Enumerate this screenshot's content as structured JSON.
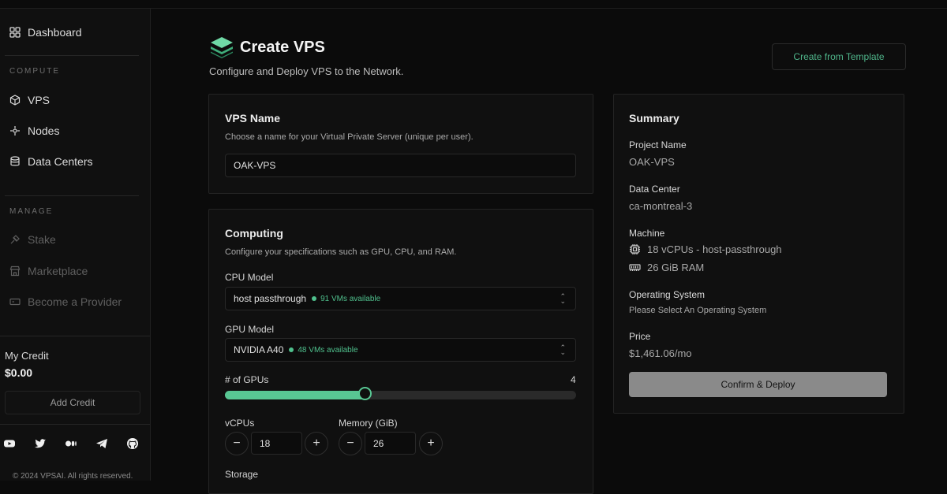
{
  "sidebar": {
    "dashboard": "Dashboard",
    "compute_label": "COMPUTE",
    "compute_items": [
      {
        "label": "VPS",
        "icon": "cube-icon"
      },
      {
        "label": "Nodes",
        "icon": "nodes-icon"
      },
      {
        "label": "Data Centers",
        "icon": "database-icon"
      }
    ],
    "manage_label": "MANAGE",
    "manage_items": [
      {
        "label": "Stake",
        "icon": "stake-icon"
      },
      {
        "label": "Marketplace",
        "icon": "store-icon"
      },
      {
        "label": "Become a Provider",
        "icon": "server-icon"
      }
    ],
    "credit_label": "My Credit",
    "credit_value": "$0.00",
    "add_credit": "Add Credit",
    "socials": [
      "youtube-icon",
      "twitter-icon",
      "medium-icon",
      "telegram-icon",
      "github-icon"
    ],
    "copyright": "© 2024 VPSAI. All rights reserved."
  },
  "header": {
    "title": "Create VPS",
    "subtitle": "Configure and Deploy VPS to the Network.",
    "template_button": "Create from Template"
  },
  "vps_name": {
    "title": "VPS Name",
    "description": "Choose a name for your Virtual Private Server (unique per user).",
    "value": "OAK-VPS"
  },
  "computing": {
    "title": "Computing",
    "description": "Configure your specifications such as GPU, CPU, and RAM.",
    "cpu_label": "CPU Model",
    "cpu_value": "host passthrough",
    "cpu_available": "91 VMs available",
    "gpu_label": "GPU Model",
    "gpu_value": "NVIDIA A40",
    "gpu_available": "48 VMs available",
    "gpus_label": "# of GPUs",
    "gpus_value": "4",
    "gpus_fill_fraction": 0.4,
    "vcpus_label": "vCPUs",
    "vcpus_value": "18",
    "memory_label": "Memory (GiB)",
    "memory_value": "26",
    "minus": "−",
    "plus": "+",
    "storage_label": "Storage"
  },
  "summary": {
    "title": "Summary",
    "project_label": "Project Name",
    "project_value": "OAK-VPS",
    "datacenter_label": "Data Center",
    "datacenter_value": "ca-montreal-3",
    "machine_label": "Machine",
    "machine_cpu": "18 vCPUs - host-passthrough",
    "machine_ram": "26 GiB RAM",
    "os_label": "Operating System",
    "os_value": "Please Select An Operating System",
    "price_label": "Price",
    "price_value": "$1,461.06/mo",
    "confirm_button": "Confirm & Deploy"
  },
  "colors": {
    "accent": "#58c693",
    "background": "#0b0b0b",
    "card": "#101010"
  }
}
